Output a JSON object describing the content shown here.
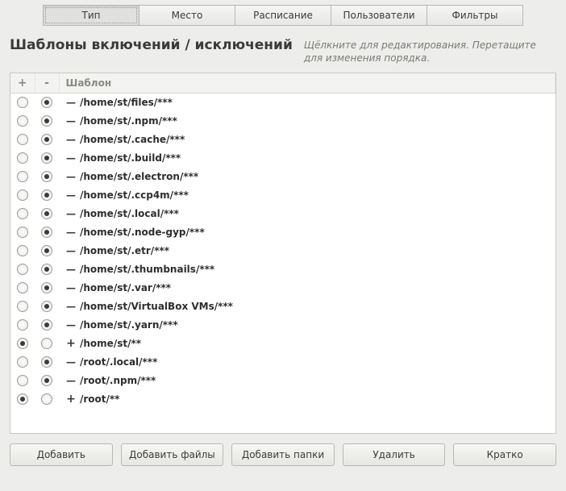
{
  "tabs": [
    {
      "label": "Тип",
      "active": true
    },
    {
      "label": "Место",
      "active": false
    },
    {
      "label": "Расписание",
      "active": false
    },
    {
      "label": "Пользователи",
      "active": false
    },
    {
      "label": "Фильтры",
      "active": false
    }
  ],
  "heading": "Шаблоны включений / исключений",
  "hint": "Щёлкните для редактирования. Перетащите для изменения порядка.",
  "columns": {
    "plus": "+",
    "minus": "-",
    "pattern": "Шаблон"
  },
  "patterns": [
    {
      "include": false,
      "exclude": true,
      "path": "/home/st/files/***"
    },
    {
      "include": false,
      "exclude": true,
      "path": "/home/st/.npm/***"
    },
    {
      "include": false,
      "exclude": true,
      "path": "/home/st/.cache/***"
    },
    {
      "include": false,
      "exclude": true,
      "path": "/home/st/.build/***"
    },
    {
      "include": false,
      "exclude": true,
      "path": "/home/st/.electron/***"
    },
    {
      "include": false,
      "exclude": true,
      "path": "/home/st/.ccp4m/***"
    },
    {
      "include": false,
      "exclude": true,
      "path": "/home/st/.local/***"
    },
    {
      "include": false,
      "exclude": true,
      "path": "/home/st/.node-gyp/***"
    },
    {
      "include": false,
      "exclude": true,
      "path": "/home/st/.etr/***"
    },
    {
      "include": false,
      "exclude": true,
      "path": "/home/st/.thumbnails/***"
    },
    {
      "include": false,
      "exclude": true,
      "path": "/home/st/.var/***"
    },
    {
      "include": false,
      "exclude": true,
      "path": "/home/st/VirtualBox VMs/***"
    },
    {
      "include": false,
      "exclude": true,
      "path": "/home/st/.yarn/***"
    },
    {
      "include": true,
      "exclude": false,
      "path": "/home/st/**"
    },
    {
      "include": false,
      "exclude": true,
      "path": "/root/.local/***"
    },
    {
      "include": false,
      "exclude": true,
      "path": "/root/.npm/***"
    },
    {
      "include": true,
      "exclude": false,
      "path": "/root/**"
    }
  ],
  "buttons": {
    "add": "Добавить",
    "add_files": "Добавить файлы",
    "add_folders": "Добавить папки",
    "delete": "Удалить",
    "brief": "Кратко"
  }
}
